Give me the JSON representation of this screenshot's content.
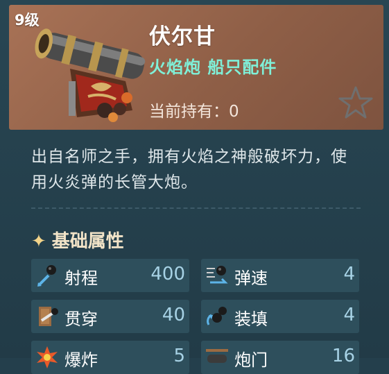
{
  "item": {
    "level": "9级",
    "name": "伏尔甘",
    "category": "火焰炮 船只配件",
    "holding": "当前持有：0",
    "icon": "cannon-icon",
    "favorite_icon": "star-icon"
  },
  "description": "出自名师之手，拥有火焰之神般破坏力，使用火炎弹的长管大炮。",
  "section": {
    "marker": "✦",
    "title": "基础属性"
  },
  "stats": [
    {
      "label": "射程",
      "value": "400",
      "icon": "range-icon"
    },
    {
      "label": "弹速",
      "value": "4",
      "icon": "shell-speed-icon"
    },
    {
      "label": "贯穿",
      "value": "40",
      "icon": "penetration-icon"
    },
    {
      "label": "装填",
      "value": "4",
      "icon": "reload-icon"
    },
    {
      "label": "爆炸",
      "value": "5",
      "icon": "explosion-icon"
    },
    {
      "label": "炮门",
      "value": "16",
      "icon": "gunport-icon"
    }
  ],
  "colors": {
    "header": "#a87256",
    "accent": "#7ff0d8",
    "panel": "#243f4c",
    "stat_value": "#a7d2e5"
  }
}
